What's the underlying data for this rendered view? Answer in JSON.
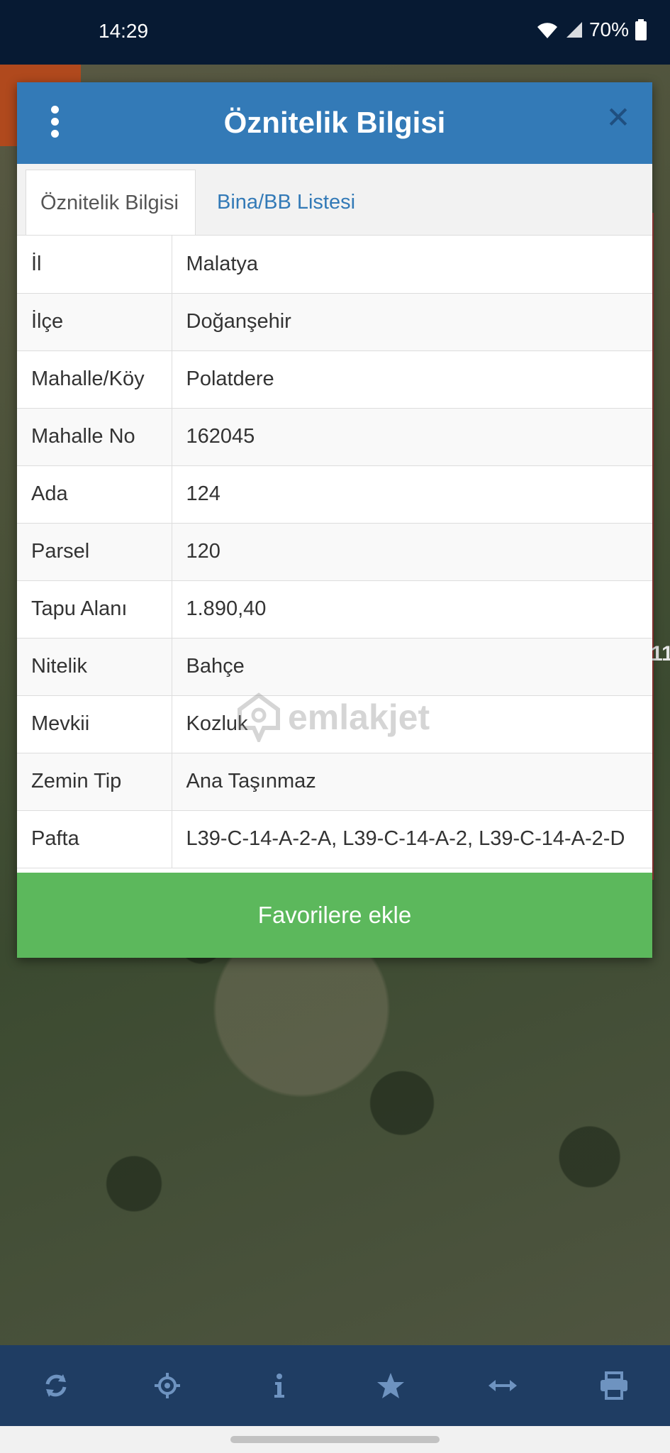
{
  "status_bar": {
    "time": "14:29",
    "battery": "70%"
  },
  "dialog": {
    "title": "Öznitelik Bilgisi",
    "tabs": [
      {
        "label": "Öznitelik Bilgisi",
        "active": true
      },
      {
        "label": "Bina/BB Listesi",
        "active": false
      }
    ],
    "rows": [
      {
        "key": "İl",
        "value": "Malatya"
      },
      {
        "key": "İlçe",
        "value": "Doğanşehir"
      },
      {
        "key": "Mahalle/Köy",
        "value": "Polatdere"
      },
      {
        "key": "Mahalle No",
        "value": "162045"
      },
      {
        "key": "Ada",
        "value": "124"
      },
      {
        "key": "Parsel",
        "value": "120"
      },
      {
        "key": "Tapu Alanı",
        "value": "1.890,40"
      },
      {
        "key": "Nitelik",
        "value": "Bahçe"
      },
      {
        "key": "Mevkii",
        "value": "Kozluk"
      },
      {
        "key": "Zemin Tip",
        "value": "Ana Taşınmaz"
      },
      {
        "key": "Pafta",
        "value": "L39-C-14-A-2-A, L39-C-14-A-2, L39-C-14-A-2-D"
      }
    ],
    "favorite_button": "Favorilere ekle"
  },
  "watermark": "emlakjet",
  "map_edge_text": "11",
  "toolbar": {
    "icons": [
      "refresh-icon",
      "locate-icon",
      "info-icon",
      "star-icon",
      "measure-icon",
      "print-icon"
    ]
  },
  "colors": {
    "header": "#337ab7",
    "button": "#5cb85c",
    "toolbar": "#1f3d63",
    "status_bar": "#071a33"
  }
}
